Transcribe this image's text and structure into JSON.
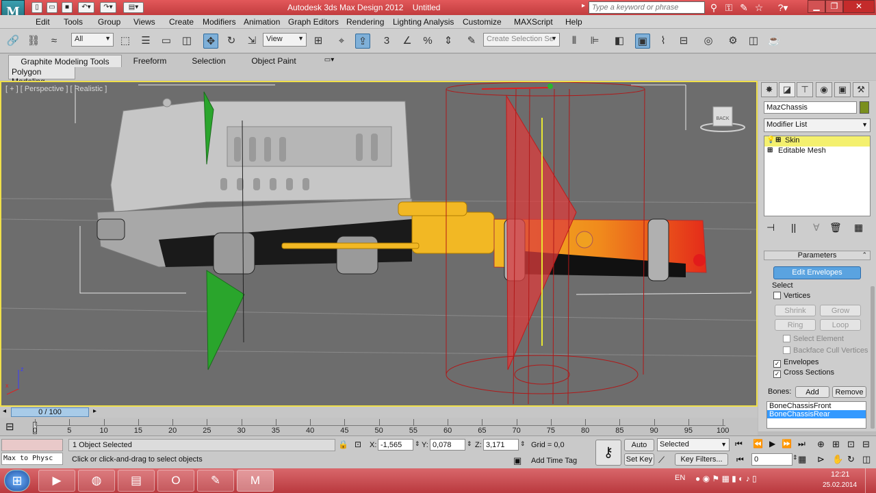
{
  "app": {
    "logo_text": "M",
    "title": "Autodesk 3ds Max Design 2012",
    "doc_title": "Untitled",
    "search_placeholder": "Type a keyword or phrase"
  },
  "menu": [
    "Edit",
    "Tools",
    "Group",
    "Views",
    "Create",
    "Modifiers",
    "Animation",
    "Graph Editors",
    "Rendering",
    "Lighting Analysis",
    "Customize",
    "MAXScript",
    "Help"
  ],
  "toolbar": {
    "selection_filter": "All",
    "ref_coord": "View",
    "named_selection": "Create Selection Se"
  },
  "ribbon": {
    "tabs": [
      "Graphite Modeling Tools",
      "Freeform",
      "Selection",
      "Object Paint"
    ],
    "panel": "Polygon Modeling"
  },
  "viewport": {
    "label": "[ + ] [ Perspective ] [ Realistic ]",
    "viewcube": "BACK",
    "axis_z": "z",
    "axis_x": "x"
  },
  "command_panel": {
    "object_name": "MazChassis",
    "object_color": "#7a8f1e",
    "modifier_list": "Modifier List",
    "stack": [
      "Skin",
      "Editable Mesh"
    ],
    "params_title": "Parameters",
    "edit_envelopes": "Edit Envelopes",
    "select_label": "Select",
    "vertices": "Vertices",
    "shrink": "Shrink",
    "grow": "Grow",
    "ring": "Ring",
    "loop": "Loop",
    "select_element": "Select Element",
    "backface": "Backface Cull Vertices",
    "envelopes": "Envelopes",
    "cross_sections": "Cross Sections",
    "bones_label": "Bones:",
    "add": "Add",
    "remove": "Remove",
    "bones": [
      "BoneChassisFront",
      "BoneChassisRear"
    ]
  },
  "timeline": {
    "frame": "0 / 100",
    "ticks": [
      "0",
      "5",
      "10",
      "15",
      "20",
      "25",
      "30",
      "35",
      "40",
      "45",
      "50",
      "55",
      "60",
      "65",
      "70",
      "75",
      "80",
      "85",
      "90",
      "95",
      "100"
    ]
  },
  "status": {
    "maxscript": "Max to Physc",
    "selected": "1 Object Selected",
    "prompt": "Click or click-and-drag to select objects",
    "x_label": "X:",
    "x": "-1,565",
    "y_label": "Y:",
    "y": "0,078",
    "z_label": "Z:",
    "z": "3,171",
    "grid": "Grid = 0,0",
    "add_time_tag": "Add Time Tag",
    "auto_key": "Auto Key",
    "set_key": "Set Key",
    "key_mode": "Selected",
    "key_filters": "Key Filters...",
    "frame_field": "0"
  },
  "taskbar": {
    "lang": "EN",
    "time": "12:21",
    "date": "25.02.2014"
  }
}
